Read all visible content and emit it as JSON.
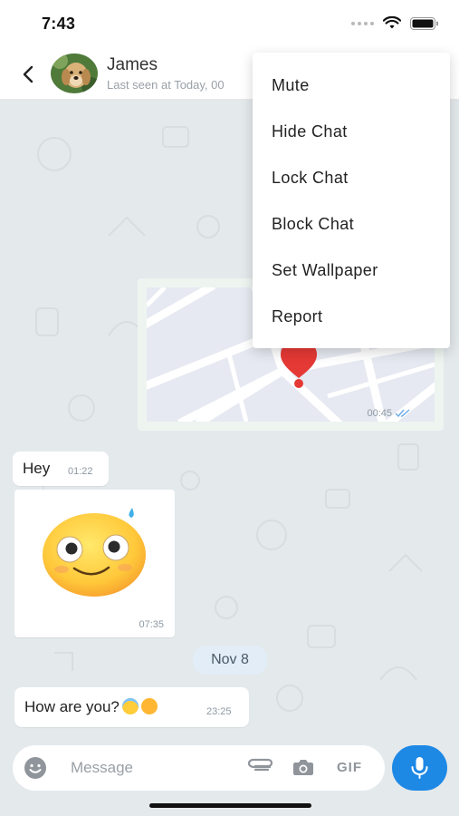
{
  "status_bar": {
    "time": "7:43"
  },
  "header": {
    "name": "James",
    "last_seen": "Last seen at Today, 00"
  },
  "messages": {
    "location_time": "00:45",
    "hey": {
      "text": "Hey",
      "time": "01:22"
    },
    "sticker": {
      "time": "07:35"
    },
    "date_divider": "Nov 8",
    "how": {
      "text": "How are you?",
      "time": "23:25"
    }
  },
  "composer": {
    "placeholder": "Message",
    "gif": "GIF"
  },
  "menu": {
    "items": [
      "Mute",
      "Hide Chat",
      "Lock Chat",
      "Block Chat",
      "Set Wallpaper",
      "Report"
    ]
  },
  "colors": {
    "accent": "#1e88e5",
    "chat_bg": "#e4e9ec",
    "map_pin": "#e53935"
  }
}
